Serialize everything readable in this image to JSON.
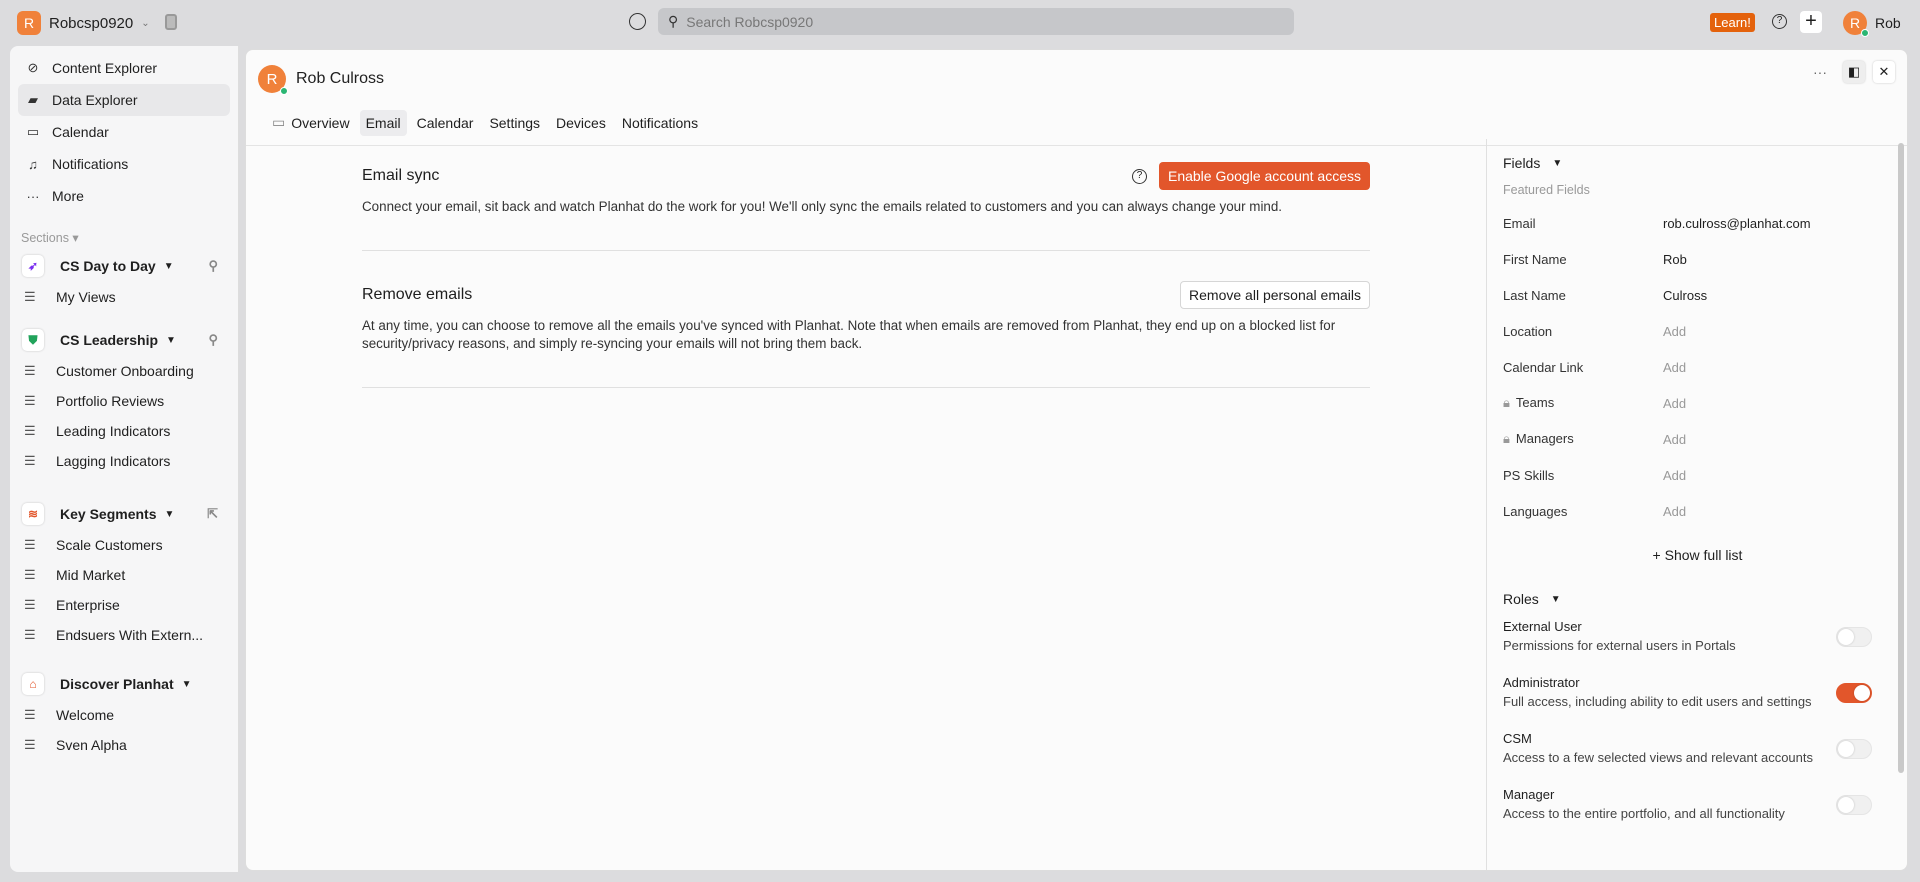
{
  "topbar": {
    "workspace_initial": "R",
    "workspace": "Robcsp0920",
    "search_placeholder": "Search Robcsp0920",
    "learn": "Learn!",
    "user_initial": "R",
    "user": "Rob"
  },
  "sidebar": {
    "nav": [
      {
        "label": "Content Explorer",
        "icon": "compass-icon"
      },
      {
        "label": "Data Explorer",
        "icon": "chart-icon"
      },
      {
        "label": "Calendar",
        "icon": "calendar-icon"
      },
      {
        "label": "Notifications",
        "icon": "bell-icon"
      },
      {
        "label": "More",
        "icon": "more-icon"
      }
    ],
    "sections_label": "Sections",
    "groups": [
      {
        "name": "CS Day to Day",
        "items": [
          "My Views"
        ]
      },
      {
        "name": "CS Leadership",
        "items": [
          "Customer Onboarding",
          "Portfolio Reviews",
          "Leading Indicators",
          "Lagging Indicators"
        ]
      },
      {
        "name": "Key Segments",
        "items": [
          "Scale Customers",
          "Mid Market",
          "Enterprise",
          "Endsuers With Extern..."
        ]
      },
      {
        "name": "Discover Planhat",
        "items": [
          "Welcome",
          "Sven Alpha"
        ]
      }
    ]
  },
  "panel": {
    "initial": "R",
    "name": "Rob Culross",
    "tabs": [
      "Overview",
      "Email",
      "Calendar",
      "Settings",
      "Devices",
      "Notifications"
    ],
    "active_tab": "Email"
  },
  "email_sync": {
    "title": "Email sync",
    "button": "Enable Google account access",
    "desc": "Connect your email, sit back and watch Planhat do the work for you! We'll only sync the emails related to customers and you can always change your mind."
  },
  "remove": {
    "title": "Remove emails",
    "button": "Remove all personal emails",
    "desc": "At any time, you can choose to remove all the emails you've synced with Planhat. Note that when emails are removed from Planhat, they end up on a blocked list for security/privacy reasons, and simply re-syncing your emails will not bring them back."
  },
  "fields": {
    "title": "Fields",
    "featured": "Featured Fields",
    "rows": [
      {
        "k": "Email",
        "v": "rob.culross@planhat.com"
      },
      {
        "k": "First Name",
        "v": "Rob"
      },
      {
        "k": "Last Name",
        "v": "Culross"
      },
      {
        "k": "Location",
        "v": "Add"
      },
      {
        "k": "Calendar Link",
        "v": "Add"
      },
      {
        "k": "Teams",
        "v": "Add"
      },
      {
        "k": "Managers",
        "v": "Add"
      },
      {
        "k": "PS Skills",
        "v": "Add"
      },
      {
        "k": "Languages",
        "v": "Add"
      }
    ],
    "show_full": "Show full list"
  },
  "roles": {
    "title": "Roles",
    "items": [
      {
        "name": "External User",
        "desc": "Permissions for external users in Portals",
        "on": false
      },
      {
        "name": "Administrator",
        "desc": "Full access, including ability to edit users and settings",
        "on": true
      },
      {
        "name": "CSM",
        "desc": "Access to a few selected views and relevant accounts",
        "on": false
      },
      {
        "name": "Manager",
        "desc": "Access to the entire portfolio, and all functionality",
        "on": false
      }
    ]
  },
  "colors": {
    "accent": "#e2562b",
    "avatar": "#f0813a",
    "learn": "#e4620c"
  }
}
